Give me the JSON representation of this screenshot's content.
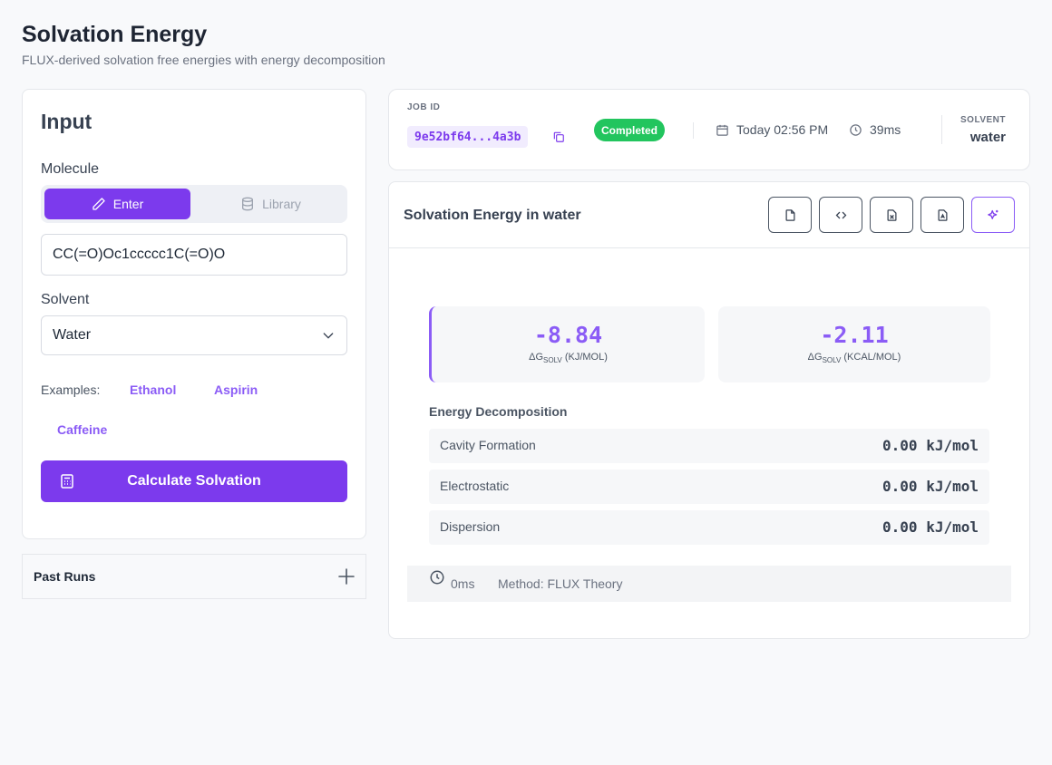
{
  "header": {
    "title": "Solvation Energy",
    "subtitle": "FLUX-derived solvation free energies with energy decomposition"
  },
  "input": {
    "title": "Input",
    "molecule_label": "Molecule",
    "tab_enter": "Enter",
    "tab_library": "Library",
    "smiles_value": "CC(=O)Oc1ccccc1C(=O)O",
    "solvent_label": "Solvent",
    "solvent_selected": "Water",
    "examples_label": "Examples:",
    "examples": [
      "Ethanol",
      "Aspirin",
      "Caffeine"
    ],
    "calculate_label": "Calculate Solvation"
  },
  "past_runs": {
    "label": "Past Runs"
  },
  "job": {
    "id_label": "JOB ID",
    "id_value": "9e52bf64...4a3b",
    "status": "Completed",
    "timestamp": "Today 02:56 PM",
    "duration": "39ms",
    "solvent_label": "SOLVENT",
    "solvent_value": "water",
    "status_color": "#22c55e"
  },
  "result": {
    "title": "Solvation Energy in water",
    "primary": {
      "value": "-8.84",
      "label_main": "ΔG",
      "label_sub": "SOLV",
      "label_unit": "(KJ/MOL)"
    },
    "secondary": {
      "value": "-2.11",
      "label_main": "ΔG",
      "label_sub": "SOLV",
      "label_unit": "(KCAL/MOL)"
    },
    "decomposition_title": "Energy Decomposition",
    "decomposition": [
      {
        "name": "Cavity Formation",
        "value": "0.00 kJ/mol"
      },
      {
        "name": "Electrostatic",
        "value": "0.00 kJ/mol"
      },
      {
        "name": "Dispersion",
        "value": "0.00 kJ/mol"
      }
    ],
    "footer_time": "0ms",
    "footer_method": "Method: FLUX Theory"
  },
  "colors": {
    "accent": "#7c3aed",
    "accent_light": "#8b5cf6",
    "success": "#22c55e"
  }
}
